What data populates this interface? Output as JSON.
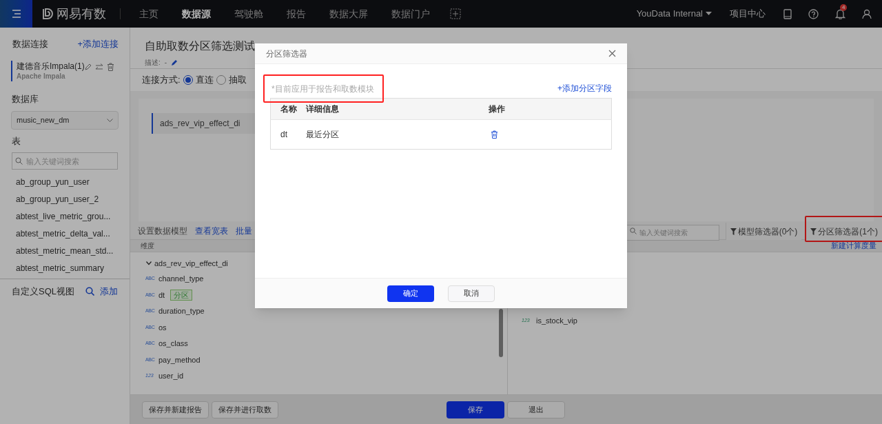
{
  "nav": {
    "logo": "网易有数",
    "items": [
      {
        "label": "主页",
        "selected": false
      },
      {
        "label": "数据源",
        "selected": true
      },
      {
        "label": "驾驶舱",
        "selected": false
      },
      {
        "label": "报告",
        "selected": false
      },
      {
        "label": "数据大屏",
        "selected": false
      },
      {
        "label": "数据门户",
        "selected": false
      }
    ],
    "workspace": "YouData Internal",
    "project_center": "项目中心",
    "notification_count": "4"
  },
  "sidebar": {
    "connections_title": "数据连接",
    "add_connection": "+添加连接",
    "connection": {
      "name": "建德音乐Impala(1)",
      "type": "Apache Impala"
    },
    "database_label": "数据库",
    "database": "music_new_dm",
    "table_label": "表",
    "search_placeholder": "输入关键词搜索",
    "tables": [
      "ab_group_yun_user",
      "ab_group_yun_user_2",
      "abtest_live_metric_grou...",
      "abtest_metric_delta_val...",
      "abtest_metric_mean_std...",
      "abtest_metric_summary"
    ],
    "sql_view_label": "自定义SQL视图",
    "sql_view_add": "添加"
  },
  "main": {
    "title": "自助取数分区筛选测试",
    "description_label": "描述:",
    "description": "-",
    "connection_mode_label": "连接方式:",
    "connection_modes": [
      {
        "label": "直连",
        "selected": true
      },
      {
        "label": "抽取",
        "selected": false
      }
    ],
    "canvas_table": "ads_rev_vip_effect_di",
    "toolbar": {
      "title": "设置数据模型",
      "links": [
        "查看宽表",
        "批量"
      ],
      "search_placeholder": "输入关键词搜索",
      "filters": [
        {
          "label": "模型筛选器(0个)",
          "highlighted": false
        },
        {
          "label": "分区筛选器(1个)",
          "highlighted": true
        }
      ]
    },
    "dimensions": {
      "header": "维度",
      "group": "ads_rev_vip_effect_di",
      "fields": [
        {
          "type_label": "ABC",
          "kind": "text",
          "name": "channel_type"
        },
        {
          "type_label": "ABC",
          "kind": "text",
          "name": "dt",
          "tag": "分区"
        },
        {
          "type_label": "ABC",
          "kind": "text",
          "name": "duration_type"
        },
        {
          "type_label": "ABC",
          "kind": "text",
          "name": "os"
        },
        {
          "type_label": "ABC",
          "kind": "text",
          "name": "os_class"
        },
        {
          "type_label": "ABC",
          "kind": "text",
          "name": "pay_method"
        },
        {
          "type_label": "123",
          "kind": "number",
          "name": "user_id"
        }
      ]
    },
    "measures": {
      "new_measure": "新建计算度量",
      "fields": [
        {
          "type_label": "123",
          "kind": "number",
          "name": "is_stock_vip"
        }
      ]
    },
    "footer": {
      "left_buttons": [
        "保存并新建报告",
        "保存并进行取数"
      ],
      "save": "保存",
      "exit": "退出"
    }
  },
  "dialog": {
    "title": "分区筛选器",
    "note": "*目前应用于报告和取数模块",
    "note_highlighted": true,
    "add_field": "+添加分区字段",
    "columns": [
      "名称",
      "详细信息",
      "操作"
    ],
    "rows": [
      {
        "name": "dt",
        "detail": "最近分区"
      }
    ],
    "ok": "确定",
    "cancel": "取消"
  }
}
